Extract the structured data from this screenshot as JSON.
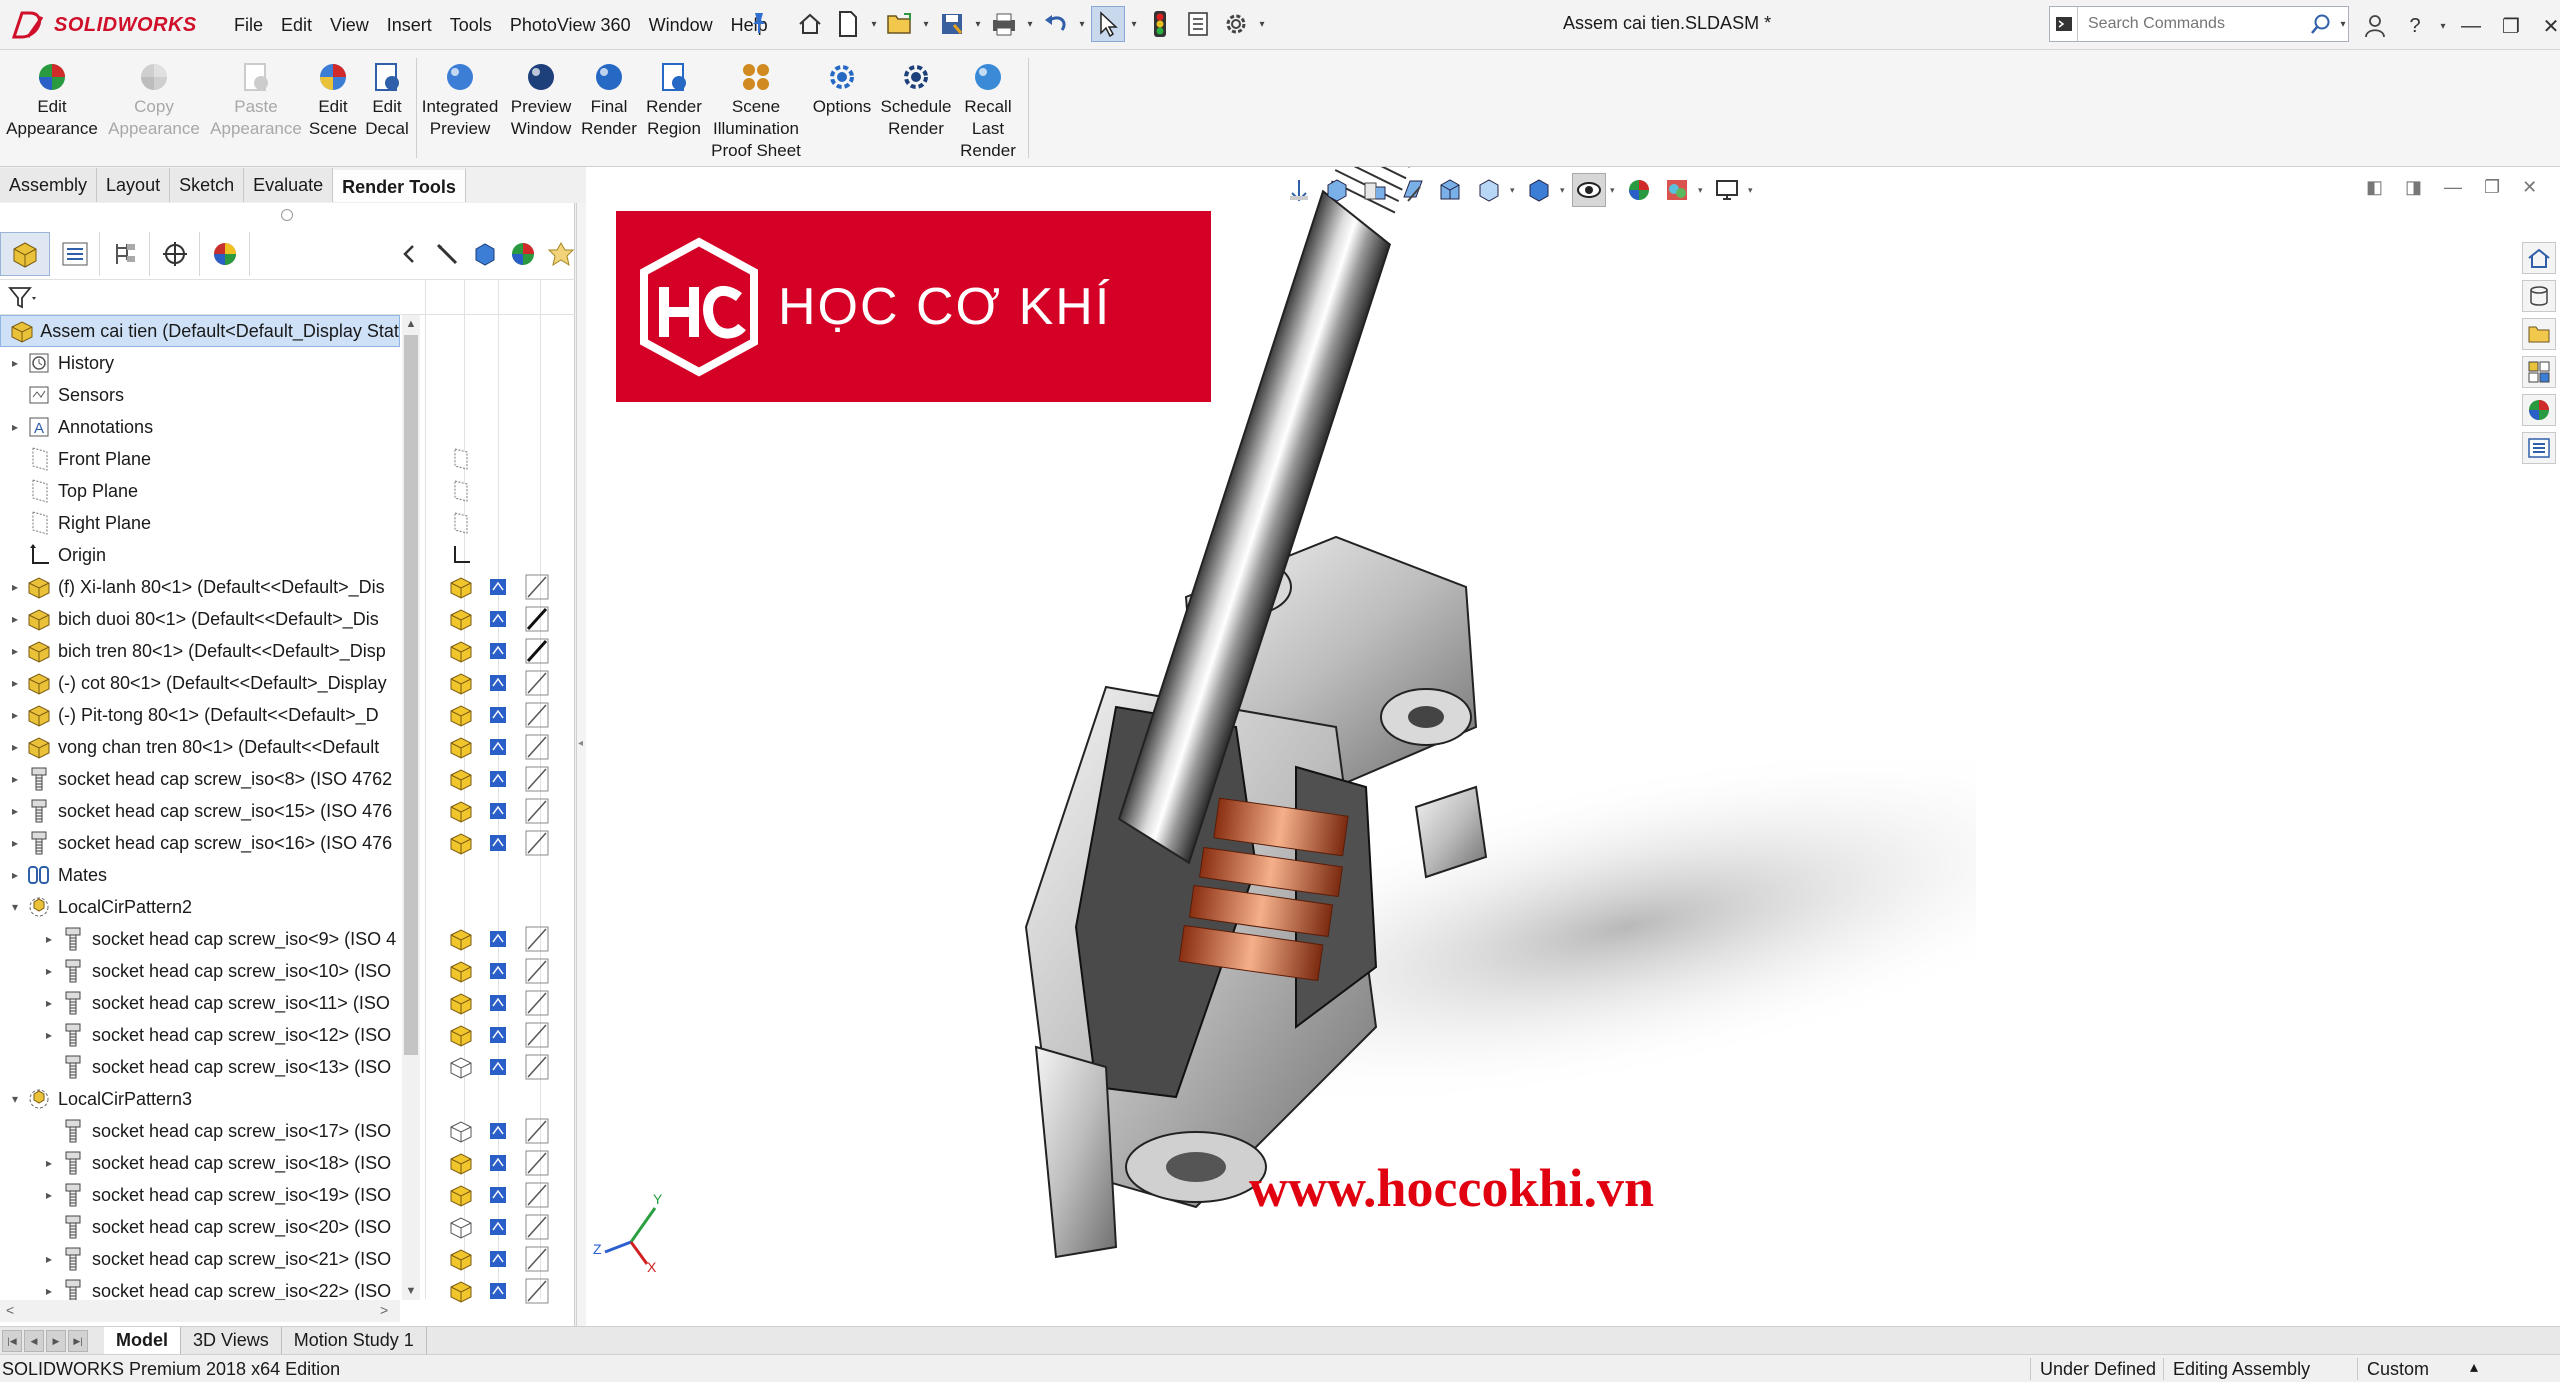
{
  "app": {
    "brand": "SOLIDWORKS",
    "document_title": "Assem cai tien.SLDASM *"
  },
  "menu": [
    "File",
    "Edit",
    "View",
    "Insert",
    "Tools",
    "PhotoView 360",
    "Window",
    "Help"
  ],
  "search": {
    "placeholder": "Search Commands"
  },
  "ribbon": [
    {
      "label": "Edit\nAppearance",
      "icon": "edit-appearance-icon",
      "enabled": true
    },
    {
      "label": "Copy\nAppearance",
      "icon": "copy-appearance-icon",
      "enabled": false
    },
    {
      "label": "Paste\nAppearance",
      "icon": "paste-appearance-icon",
      "enabled": false
    },
    {
      "label": "Edit\nScene",
      "icon": "edit-scene-icon",
      "enabled": true
    },
    {
      "label": "Edit\nDecal",
      "icon": "edit-decal-icon",
      "enabled": true
    },
    {
      "label": "Integrated\nPreview",
      "icon": "integrated-preview-icon",
      "enabled": true
    },
    {
      "label": "Preview\nWindow",
      "icon": "preview-window-icon",
      "enabled": true
    },
    {
      "label": "Final\nRender",
      "icon": "final-render-icon",
      "enabled": true
    },
    {
      "label": "Render\nRegion",
      "icon": "render-region-icon",
      "enabled": true
    },
    {
      "label": "Scene\nIllumination\nProof Sheet",
      "icon": "scene-illumination-icon",
      "enabled": true
    },
    {
      "label": "Options",
      "icon": "options-icon",
      "enabled": true
    },
    {
      "label": "Schedule\nRender",
      "icon": "schedule-render-icon",
      "enabled": true
    },
    {
      "label": "Recall\nLast\nRender",
      "icon": "recall-last-render-icon",
      "enabled": true
    }
  ],
  "cm_tabs": [
    "Assembly",
    "Layout",
    "Sketch",
    "Evaluate",
    "Render Tools"
  ],
  "cm_active_tab": "Render Tools",
  "tree": [
    {
      "label": "Assem cai tien  (Default<Default_Display State",
      "type": "root",
      "indent": 0,
      "expander": "",
      "marks": []
    },
    {
      "label": "History",
      "type": "history",
      "indent": 0,
      "expander": "▸",
      "marks": []
    },
    {
      "label": "Sensors",
      "type": "sensor",
      "indent": 0,
      "expander": "",
      "marks": []
    },
    {
      "label": "Annotations",
      "type": "annotation",
      "indent": 0,
      "expander": "▸",
      "marks": []
    },
    {
      "label": "Front Plane",
      "type": "plane",
      "indent": 0,
      "expander": "",
      "marks": [
        "plane"
      ]
    },
    {
      "label": "Top Plane",
      "type": "plane",
      "indent": 0,
      "expander": "",
      "marks": [
        "plane"
      ]
    },
    {
      "label": "Right Plane",
      "type": "plane",
      "indent": 0,
      "expander": "",
      "marks": [
        "plane"
      ]
    },
    {
      "label": "Origin",
      "type": "origin",
      "indent": 0,
      "expander": "",
      "marks": [
        "origin"
      ]
    },
    {
      "label": "(f) Xi-lanh 80<1> (Default<<Default>_Dis",
      "type": "part",
      "indent": 0,
      "expander": "▸",
      "marks": [
        "part",
        "cfg",
        "slash"
      ]
    },
    {
      "label": "bich duoi 80<1> (Default<<Default>_Dis",
      "type": "part",
      "indent": 0,
      "expander": "▸",
      "marks": [
        "part",
        "cfg",
        "slash-b"
      ]
    },
    {
      "label": "bich tren 80<1> (Default<<Default>_Disp",
      "type": "part",
      "indent": 0,
      "expander": "▸",
      "marks": [
        "part",
        "cfg",
        "slash-b"
      ]
    },
    {
      "label": "(-) cot 80<1> (Default<<Default>_Display",
      "type": "part",
      "indent": 0,
      "expander": "▸",
      "marks": [
        "part",
        "cfg",
        "slash"
      ]
    },
    {
      "label": "(-) Pit-tong 80<1> (Default<<Default>_D",
      "type": "part",
      "indent": 0,
      "expander": "▸",
      "marks": [
        "part",
        "cfg",
        "slash"
      ]
    },
    {
      "label": "vong chan tren 80<1> (Default<<Default",
      "type": "part",
      "indent": 0,
      "expander": "▸",
      "marks": [
        "part",
        "cfg",
        "slash"
      ]
    },
    {
      "label": "socket head cap screw_iso<8> (ISO 4762",
      "type": "screw",
      "indent": 0,
      "expander": "▸",
      "marks": [
        "part",
        "cfg",
        "slash"
      ]
    },
    {
      "label": "socket head cap screw_iso<15> (ISO 476",
      "type": "screw",
      "indent": 0,
      "expander": "▸",
      "marks": [
        "part",
        "cfg",
        "slash"
      ]
    },
    {
      "label": "socket head cap screw_iso<16> (ISO 476",
      "type": "screw",
      "indent": 0,
      "expander": "▸",
      "marks": [
        "part",
        "cfg",
        "slash"
      ]
    },
    {
      "label": "Mates",
      "type": "mates",
      "indent": 0,
      "expander": "▸",
      "marks": []
    },
    {
      "label": "LocalCirPattern2",
      "type": "pattern",
      "indent": 0,
      "expander": "▾",
      "marks": []
    },
    {
      "label": "socket head cap screw_iso<9> (ISO 4",
      "type": "screw",
      "indent": 1,
      "expander": "▸",
      "marks": [
        "part",
        "cfg",
        "slash"
      ]
    },
    {
      "label": "socket head cap screw_iso<10> (ISO",
      "type": "screw",
      "indent": 1,
      "expander": "▸",
      "marks": [
        "part",
        "cfg",
        "slash"
      ]
    },
    {
      "label": "socket head cap screw_iso<11> (ISO",
      "type": "screw",
      "indent": 1,
      "expander": "▸",
      "marks": [
        "part",
        "cfg",
        "slash"
      ]
    },
    {
      "label": "socket head cap screw_iso<12> (ISO",
      "type": "screw",
      "indent": 1,
      "expander": "▸",
      "marks": [
        "part",
        "cfg",
        "slash"
      ]
    },
    {
      "label": "socket head cap screw_iso<13> (ISO",
      "type": "screw",
      "indent": 1,
      "expander": "",
      "marks": [
        "part-outline",
        "cfg",
        "slash"
      ]
    },
    {
      "label": "LocalCirPattern3",
      "type": "pattern",
      "indent": 0,
      "expander": "▾",
      "marks": []
    },
    {
      "label": "socket head cap screw_iso<17> (ISO",
      "type": "screw",
      "indent": 1,
      "expander": "",
      "marks": [
        "part-outline",
        "cfg",
        "slash"
      ]
    },
    {
      "label": "socket head cap screw_iso<18> (ISO",
      "type": "screw",
      "indent": 1,
      "expander": "▸",
      "marks": [
        "part",
        "cfg",
        "slash"
      ]
    },
    {
      "label": "socket head cap screw_iso<19> (ISO",
      "type": "screw",
      "indent": 1,
      "expander": "▸",
      "marks": [
        "part",
        "cfg",
        "slash"
      ]
    },
    {
      "label": "socket head cap screw_iso<20> (ISO",
      "type": "screw",
      "indent": 1,
      "expander": "",
      "marks": [
        "part-outline",
        "cfg",
        "slash"
      ]
    },
    {
      "label": "socket head cap screw_iso<21> (ISO",
      "type": "screw",
      "indent": 1,
      "expander": "▸",
      "marks": [
        "part",
        "cfg",
        "slash"
      ]
    },
    {
      "label": "socket head cap screw_iso<22> (ISO",
      "type": "screw",
      "indent": 1,
      "expander": "▸",
      "marks": [
        "part",
        "cfg",
        "slash"
      ]
    }
  ],
  "graphics": {
    "banner_text": "HỌC CƠ KHÍ",
    "website": "www.hoccokhi.vn",
    "banner_color": "#d40026",
    "website_color": "#e00010",
    "triad_labels": {
      "x": "X",
      "y": "Y",
      "z": "Z"
    }
  },
  "bottom_tabs": [
    "Model",
    "3D Views",
    "Motion Study 1"
  ],
  "bottom_active": "Model",
  "status": {
    "edition": "SOLIDWORKS Premium 2018 x64 Edition",
    "definition": "Under Defined",
    "mode": "Editing Assembly",
    "units": "Custom"
  },
  "colors": {
    "accent_red": "#d0102a",
    "tree_selection": "#cfe1f7"
  }
}
